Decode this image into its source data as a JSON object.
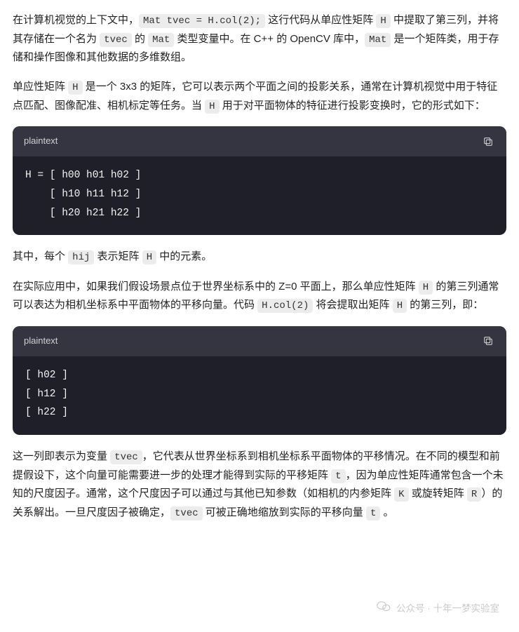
{
  "p1": {
    "s1": "在计算机视觉的上下文中，",
    "c1": "Mat tvec = H.col(2);",
    "s2": " 这行代码从单应性矩阵 ",
    "c2": "H",
    "s3": " 中提取了第三列，并将其存储在一个名为 ",
    "c3": "tvec",
    "s4": " 的 ",
    "c4": "Mat",
    "s5": " 类型变量中。在 C++ 的 OpenCV 库中，",
    "c5": "Mat",
    "s6": " 是一个矩阵类，用于存储和操作图像和其他数据的多维数组。"
  },
  "p2": {
    "s1": "单应性矩阵 ",
    "c1": "H",
    "s2": " 是一个 3x3 的矩阵，它可以表示两个平面之间的投影关系，通常在计算机视觉中用于特征点匹配、图像配准、相机标定等任务。当 ",
    "c2": "H",
    "s3": " 用于对平面物体的特征进行投影变换时，它的形式如下："
  },
  "code1": {
    "label": "plaintext",
    "content": "H = [ h00 h01 h02 ]\n    [ h10 h11 h12 ]\n    [ h20 h21 h22 ]"
  },
  "p3": {
    "s1": "其中，每个 ",
    "c1": "hij",
    "s2": " 表示矩阵 ",
    "c2": "H",
    "s3": " 中的元素。"
  },
  "p4": {
    "s1": "在实际应用中，如果我们假设场景点位于世界坐标系中的 Z=0 平面上，那么单应性矩阵 ",
    "c1": "H",
    "s2": " 的第三列通常可以表达为相机坐标系中平面物体的平移向量。代码 ",
    "c2": "H.col(2)",
    "s3": " 将会提取出矩阵 ",
    "c3": "H",
    "s4": " 的第三列，即："
  },
  "code2": {
    "label": "plaintext",
    "content": "[ h02 ]\n[ h12 ]\n[ h22 ]"
  },
  "p5": {
    "s1": "这一列即表示为变量 ",
    "c1": "tvec",
    "s2": "，它代表从世界坐标系到相机坐标系平面物体的平移情况。在不同的模型和前提假设下，这个向量可能需要进一步的处理才能得到实际的平移矩阵 ",
    "c2": "t",
    "s3": "，因为单应性矩阵通常包含一个未知的尺度因子。通常，这个尺度因子可以通过与其他已知参数（如相机的内参矩阵 ",
    "c3": "K",
    "s4": " 或旋转矩阵 ",
    "c4": "R",
    "s5": "）的关系解出。一旦尺度因子被确定，",
    "c5": "tvec",
    "s6": " 可被正确地缩放到实际的平移向量 ",
    "c6": "t",
    "s7": " 。"
  },
  "watermark": "公众号 · 十年一梦实验室"
}
